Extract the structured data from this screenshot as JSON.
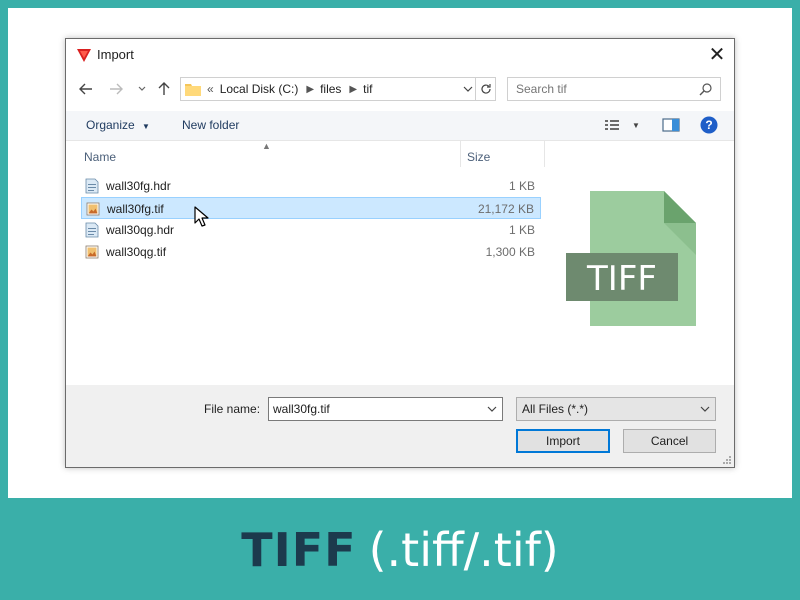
{
  "dialog": {
    "title": "Import",
    "close_glyph": "✕"
  },
  "address": {
    "overflow": "«",
    "path": [
      "Local Disk (C:)",
      "files",
      "tif"
    ]
  },
  "search": {
    "placeholder": "Search tif"
  },
  "toolbar": {
    "organize_label": "Organize",
    "new_folder_label": "New folder"
  },
  "columns": {
    "name": "Name",
    "size": "Size"
  },
  "files": [
    {
      "name": "wall30fg.hdr",
      "size": "1 KB",
      "icon": "hdr-file-icon",
      "selected": false
    },
    {
      "name": "wall30fg.tif",
      "size": "21,172 KB",
      "icon": "tif-file-icon",
      "selected": true
    },
    {
      "name": "wall30qg.hdr",
      "size": "1 KB",
      "icon": "hdr-file-icon",
      "selected": false
    },
    {
      "name": "wall30qg.tif",
      "size": "1,300 KB",
      "icon": "tif-file-icon",
      "selected": false
    }
  ],
  "preview": {
    "label": "TIFF",
    "icon": "tiff-document-icon",
    "color": "#9ccc9e"
  },
  "bottom": {
    "file_name_label": "File name:",
    "file_name_value": "wall30fg.tif",
    "filter_value": "All Files (*.*)",
    "import_label": "Import",
    "cancel_label": "Cancel"
  },
  "caption": {
    "bold": "TIFF",
    "light": "(.tiff/.tif)"
  },
  "colors": {
    "frame": "#3aafa9",
    "caption_dark": "#1c3a4d",
    "selection": "#cce8ff",
    "accent": "#0078d7"
  }
}
